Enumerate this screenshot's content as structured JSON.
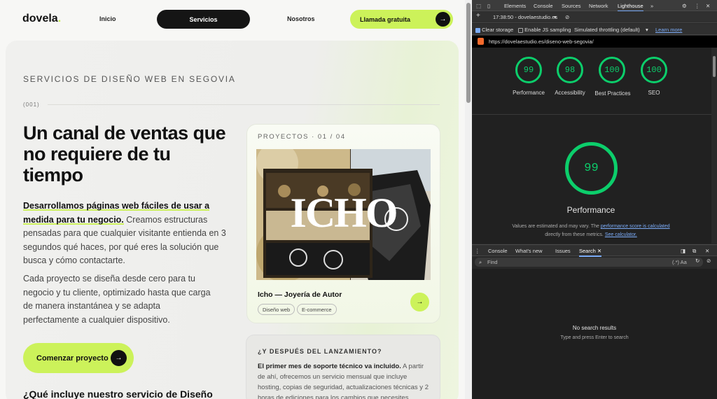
{
  "site": {
    "logo": "dovela",
    "nav": {
      "inicio": "Inicio",
      "servicios": "Servicios",
      "nosotros": "Nosotros",
      "llamada": "Llamada gratuita"
    },
    "eyebrow": "SERVICIOS DE DISEÑO WEB EN SEGOVIA",
    "section_num": "(001)",
    "headline": "Un canal de ventas que no requiere de tu tiempo",
    "p1_bold": "Desarrollamos páginas web fáciles de usar a medida para tu negocio.",
    "p1_rest": " Creamos estructuras pensadas para que cualquier visitante entienda en 3 segundos qué haces, por qué eres la solución que busca y cómo contactarte.",
    "p2": "Cada proyecto se diseña desde cero para tu negocio y tu cliente, optimizado hasta que carga de manera instantánea y se adapta perfectamente a cualquier dispositivo.",
    "cta": "Comenzar proyecto",
    "h2": "¿Qué incluye nuestro servicio de Diseño",
    "card": {
      "eyebrow": "PROYECTOS · 01 / 04",
      "image_text": "ICHO",
      "title": "Icho — Joyería de Autor",
      "tags": [
        "Diseño web",
        "E-commerce"
      ]
    },
    "card2": {
      "title": "¿Y DESPUÉS DEL LANZAMIENTO?",
      "bold": "El primer mes de soporte técnico va incluido.",
      "text": " A partir de ahí, ofrecemos un servicio mensual que incluye hosting, copias de seguridad, actualizaciones técnicas y 2 horas de ediciones para los cambios que necesites"
    }
  },
  "devtools": {
    "tabs": [
      "Elements",
      "Console",
      "Sources",
      "Network",
      "Lighthouse"
    ],
    "report": "17:38:50 - dovelaestudio.es",
    "clear_storage": "Clear storage",
    "js_sampling": "Enable JS sampling",
    "throttling": "Simulated throttling (default)",
    "learn_more": "Learn more",
    "url": "https://dovelaestudio.es/diseno-web-segovia/",
    "scores": [
      {
        "value": "99",
        "label": "Performance"
      },
      {
        "value": "98",
        "label": "Accessibility"
      },
      {
        "value": "100",
        "label": "Best Practices"
      },
      {
        "value": "100",
        "label": "SEO"
      }
    ],
    "main_score": "99",
    "main_label": "Performance",
    "note_a": "Values are estimated and may vary. The ",
    "note_link1": "performance score is calculated",
    "note_b": "directly from these metrics. ",
    "note_link2": "See calculator.",
    "drawer_tabs": [
      "Console",
      "What's new",
      "Issues",
      "Search"
    ],
    "find_placeholder": "Find",
    "find_opts": "(.*) Aa",
    "no_results": "No search results",
    "hint": "Type and press Enter to search",
    "score_color": "#0cce6b"
  }
}
